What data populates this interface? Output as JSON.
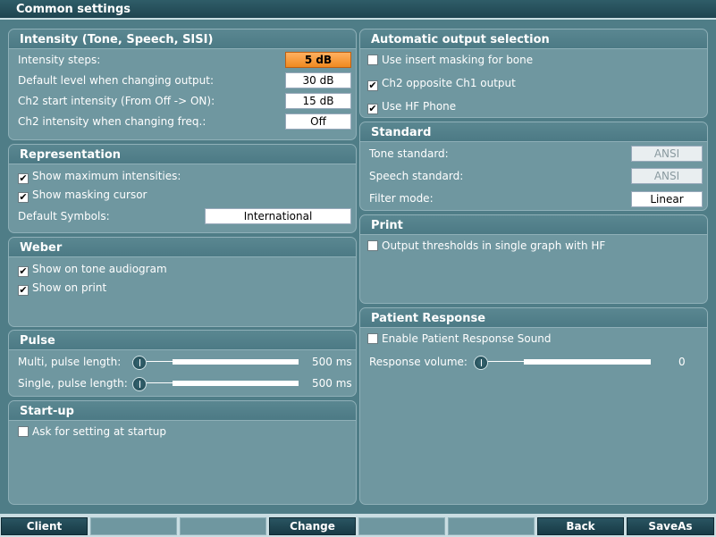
{
  "window": {
    "title": "Common settings"
  },
  "intensity": {
    "title": "Intensity (Tone, Speech, SISI)",
    "steps_label": "Intensity steps:",
    "steps_value": "5 dB",
    "default_label": "Default level when changing output:",
    "default_value": "30 dB",
    "ch2_start_label": "Ch2 start intensity (From Off -> ON):",
    "ch2_start_value": "15 dB",
    "ch2_freq_label": "Ch2 intensity when changing freq.:",
    "ch2_freq_value": "Off"
  },
  "representation": {
    "title": "Representation",
    "show_max_label": "Show maximum intensities:",
    "show_max_checked": true,
    "show_masking_label": "Show masking cursor",
    "show_masking_checked": true,
    "symbols_label": "Default Symbols:",
    "symbols_value": "International"
  },
  "weber": {
    "title": "Weber",
    "tone_label": "Show on tone audiogram",
    "tone_checked": true,
    "print_label": "Show on print",
    "print_checked": true
  },
  "pulse": {
    "title": "Pulse",
    "multi_label": "Multi, pulse length:",
    "multi_value": "500 ms",
    "single_label": "Single, pulse length:",
    "single_value": "500 ms"
  },
  "startup": {
    "title": "Start-up",
    "ask_label": "Ask for setting at startup",
    "ask_checked": false
  },
  "auto_output": {
    "title": "Automatic output selection",
    "insert_label": "Use insert masking for bone",
    "insert_checked": false,
    "ch2_label": "Ch2 opposite Ch1 output",
    "ch2_checked": true,
    "hf_label": "Use HF Phone",
    "hf_checked": true
  },
  "standard": {
    "title": "Standard",
    "tone_label": "Tone standard:",
    "tone_value": "ANSI",
    "speech_label": "Speech standard:",
    "speech_value": "ANSI",
    "filter_label": "Filter mode:",
    "filter_value": "Linear"
  },
  "print": {
    "title": "Print",
    "output_label": "Output thresholds in single graph with HF",
    "output_checked": false
  },
  "patient": {
    "title": "Patient Response",
    "sound_label": "Enable Patient Response Sound",
    "sound_checked": false,
    "volume_label": "Response volume:",
    "volume_value": "0"
  },
  "function_keys": [
    "Client",
    "",
    "",
    "Change",
    "",
    "",
    "Back",
    "SaveAs"
  ]
}
